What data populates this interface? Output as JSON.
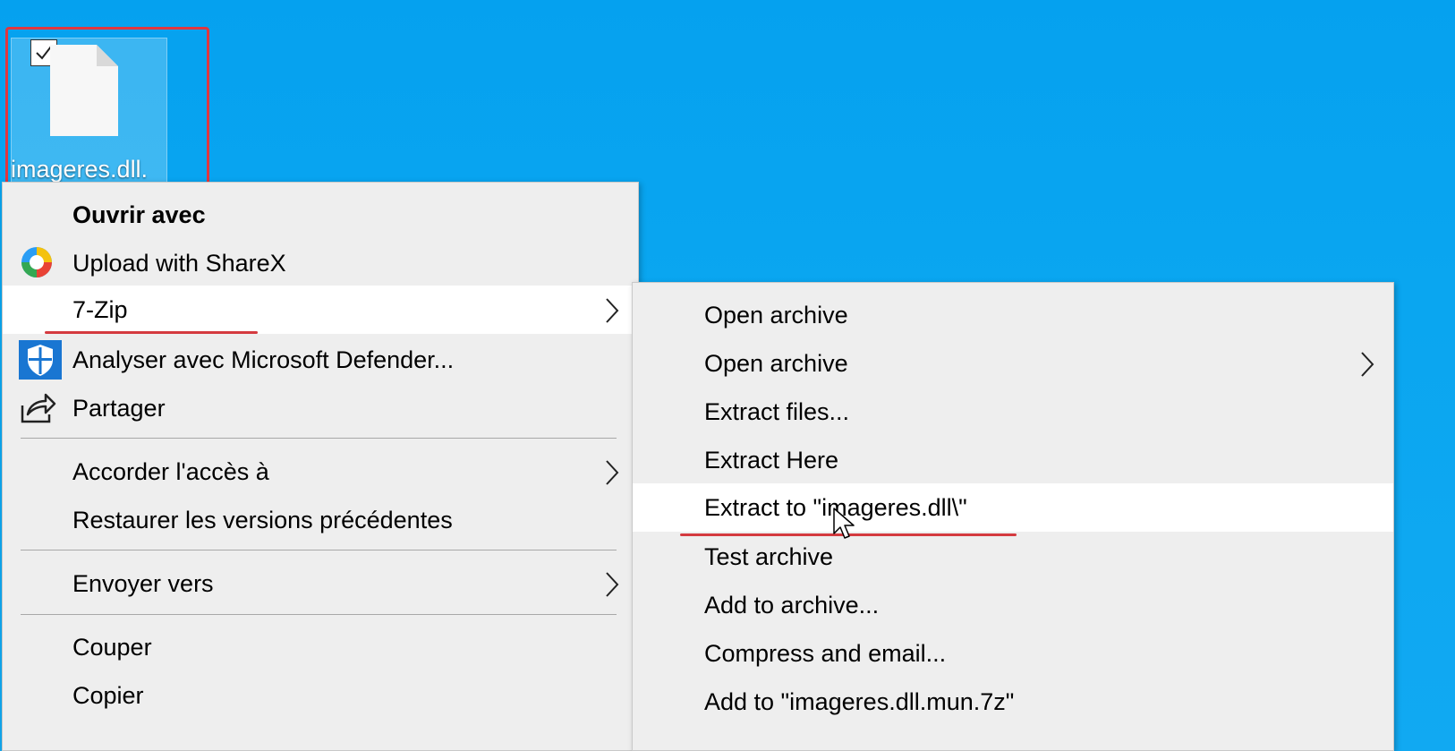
{
  "desktop": {
    "file_label": "imageres.dll.",
    "checkbox_checked": true,
    "highlight_color": "#e0363f"
  },
  "context_menu": {
    "items": [
      {
        "label": "Ouvrir avec",
        "bold": true
      },
      {
        "label": "Upload with ShareX",
        "icon": "sharex-icon"
      },
      {
        "label": "7-Zip",
        "submenu": true,
        "hovered": true
      },
      {
        "label": "Analyser avec Microsoft Defender...",
        "icon": "defender-shield-icon"
      },
      {
        "label": "Partager",
        "icon": "share-icon"
      },
      {
        "label": "Accorder l'accès à",
        "submenu": true
      },
      {
        "label": "Restaurer les versions précédentes"
      },
      {
        "label": "Envoyer vers",
        "submenu": true
      },
      {
        "label": "Couper"
      },
      {
        "label": "Copier"
      }
    ]
  },
  "sevenzip_submenu": {
    "items": [
      {
        "label": "Open archive"
      },
      {
        "label": "Open archive",
        "submenu": true
      },
      {
        "label": "Extract files..."
      },
      {
        "label": "Extract Here"
      },
      {
        "label": "Extract to \"imageres.dll\\\"",
        "hovered": true
      },
      {
        "label": "Test archive"
      },
      {
        "label": "Add to archive..."
      },
      {
        "label": "Compress and email..."
      },
      {
        "label": "Add to \"imageres.dll.mun.7z\""
      }
    ]
  },
  "colors": {
    "desktop_bg": "#0aa6f0",
    "menu_bg": "#eeeeee",
    "hover_bg": "#ffffff",
    "annotation_red": "#d43a3f"
  }
}
